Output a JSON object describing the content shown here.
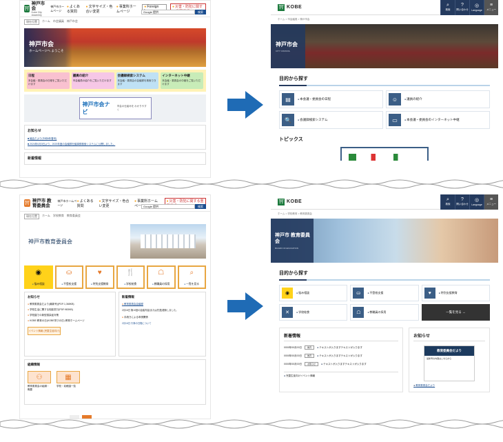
{
  "colors": {
    "arrow": "#1f6bb5",
    "kobe_navy": "#243a5e",
    "brand_green": "#1c7a3d",
    "old_orange": "#e8a640",
    "old_yellow": "#ffd21a"
  },
  "old_city": {
    "logo": "神戸市会",
    "logo_sub": "Kobe City Assembly",
    "home_link": "神戸市ホームページ",
    "links": [
      "よくある質問",
      "文字サイズ・色合い変更",
      "事業所ホームページ"
    ],
    "language": "Foreign Language",
    "search_placeholder": "Google 提供",
    "search_button": "検索",
    "info_link": "災害・防犯に関する重要情報",
    "breadcrumb": [
      "現在位置",
      "ホーム",
      "市会議員",
      "神戸市会"
    ],
    "hero_title": "神戸市会",
    "hero_sub": "ホームページへ ようこそ",
    "menu": [
      {
        "t": "日程",
        "l": "本会議・委員会の日程をご覧いただけます"
      },
      {
        "t": "議員の紹介",
        "l": "市会議員の紹介をご覧いただけます"
      },
      {
        "t": "会議録検索システム",
        "l": "本会議・委員会の会議録を検索できます"
      },
      {
        "t": "インターネット中継",
        "l": "本会議・委員会の中継をご覧いただけます"
      }
    ],
    "navi_title": "神戸市会ナビ",
    "navi_desc": "市会の仕組みを わかりやすく",
    "notice_title": "お知らせ",
    "notices": [
      "議会だより(令和6年春号)",
      "2024年6月3日より、2023年度の会議録を議事録検索システムに公開しました。"
    ],
    "section": "新着情報"
  },
  "new_city": {
    "logo": "KOBE",
    "tools": [
      "検索",
      "問い合わせ",
      "Language",
      "メニュー"
    ],
    "breadcrumb": "ホーム > 市会議員 > 神戸市会",
    "hero_title": "神戸市会",
    "hero_sub": "CITY COUNCIL",
    "purpose_title": "目的から探す",
    "cards": [
      "本会議・委員会の日程",
      "議員の紹介",
      "会議録検索システム",
      "本会議・委員会のインターネット中継"
    ],
    "topics_title": "トピックス"
  },
  "old_edu": {
    "logo": "神戸市 教育委員会",
    "home_link": "神戸市ホームページ",
    "links": [
      "よくある質問",
      "文字サイズ・色合い変更",
      "事業所ホームページ"
    ],
    "search_placeholder": "Google 提供",
    "search_button": "検索",
    "info_link": "災害・防犯に関する重要情報",
    "breadcrumb": [
      "現在位置",
      "ホーム",
      "学校教育",
      "教育委員会"
    ],
    "hero_title": "神戸市教育委員会",
    "icons": [
      "悩み相談",
      "不登校支援",
      "特別支援教育",
      "学校給食",
      "教職員の採用",
      "一覧を見る"
    ],
    "notice_title": "お知らせ",
    "notices": [
      "教育委員会だより(最新号)(PDF:1,368KB)",
      "学校生活に関する相談窓口(PDF:983KB)",
      "学校園での新型感染症対策",
      "KOBE 教育の日(KOBE学びの日) 教育ホームページ"
    ],
    "event_btn": "イベント情報 (児童生徒向け)",
    "news_title": "新着情報",
    "news": [
      "教育委員会会議録",
      "2月16日 第10回の会議内容(または先週)更新しました。",
      "手続きによる申請関係",
      "2月16日 行事の日程について"
    ],
    "org_title": "組織情報",
    "org": [
      "教育委員会の組織・概要",
      "学校・幼稚園一覧"
    ]
  },
  "new_edu": {
    "logo": "KOBE",
    "tools": [
      "検索",
      "問い合わせ",
      "Language",
      "メニュー"
    ],
    "breadcrumb": "ホーム > 学校教育 > 教育委員会",
    "hero_title": "神戸市 教育委員会",
    "hero_sub": "BOARD OF EDUCATION",
    "purpose_title": "目的から探す",
    "cards": [
      "悩み相談",
      "不登校支援",
      "特別支援教育",
      "学校給食",
      "教職員の採用",
      "一覧を見る →"
    ],
    "news_title": "新着情報",
    "news": [
      {
        "date": "0000年00月00日",
        "tag": "教育",
        "text": "テキストが入りますテキストが入ります"
      },
      {
        "date": "0000年00月00日",
        "tag": "教育",
        "text": "テキストが入りますテキストが入ります"
      },
      {
        "date": "0000年00月00日",
        "tag": "お知らせ",
        "text": "テキストが入りますテキストが入ります"
      }
    ],
    "event": "児童生徒向けイベント情報",
    "notice_title": "お知らせ",
    "paper_title": "教育委員会だより",
    "paper_text": "最新号の内容はこちらから",
    "paper_link": "教育委員会だより"
  }
}
